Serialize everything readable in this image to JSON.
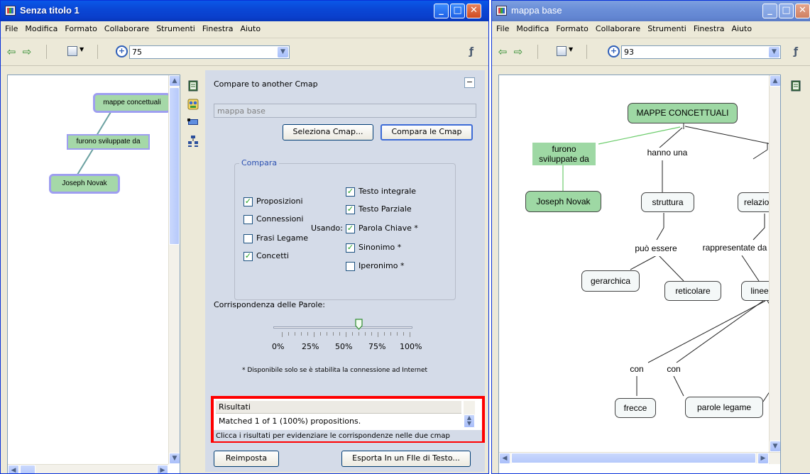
{
  "window1": {
    "title": "Senza titolo 1",
    "menu": [
      "File",
      "Modifica",
      "Formato",
      "Collaborare",
      "Strumenti",
      "Finestra",
      "Aiuto"
    ],
    "zoom": "75",
    "nodes": {
      "mappe": "mappe concettuali",
      "furono": "furono sviluppate da",
      "novak": "Joseph Novak"
    }
  },
  "panel": {
    "title": "Compare to another Cmap",
    "cmap_field": "mappa base",
    "select_button": "Seleziona Cmap...",
    "compare_button": "Compara le Cmap",
    "group_title": "Compara",
    "compare_items": [
      {
        "label": "Proposizioni",
        "checked": true
      },
      {
        "label": "Connessioni",
        "checked": false
      },
      {
        "label": "Frasi Legame",
        "checked": false
      },
      {
        "label": "Concetti",
        "checked": true
      }
    ],
    "using_label": "Usando:",
    "using_items": [
      {
        "label": "Testo integrale",
        "checked": true
      },
      {
        "label": "Testo Parziale",
        "checked": true
      },
      {
        "label": "Parola Chiave *",
        "checked": true
      },
      {
        "label": "Sinonimo *",
        "checked": true
      },
      {
        "label": "Iperonimo *",
        "checked": false
      }
    ],
    "slider_label": "Corrispondenza delle Parole:",
    "slider_value": 0.6,
    "slider_ticks": [
      "0%",
      "25%",
      "50%",
      "75%",
      "100%"
    ],
    "note": "* Disponibile solo se è stabilita la connessione ad Internet",
    "results_header": "Risultati",
    "results_row": "Matched 1 of 1 (100%) propositions.",
    "results_hint": "Clicca i risultati per evidenziare le corrispondenze nelle due cmap",
    "reset_button": "Reimposta",
    "export_button": "Esporta In un FIle di Testo..."
  },
  "window2": {
    "title": "mappa base",
    "menu": [
      "File",
      "Modifica",
      "Formato",
      "Collaborare",
      "Strumenti",
      "Finestra",
      "Aiuto"
    ],
    "zoom": "93",
    "nodes": {
      "mappe": "MAPPE CONCETTUALI",
      "furono": "furono sviluppate da",
      "hanno": "hanno una",
      "novak": "Joseph Novak",
      "struttura": "struttura",
      "relazioni": "relazio",
      "puo": "può essere",
      "rappresentate": "rappresentate da",
      "gerarchica": "gerarchica",
      "reticolare": "reticolare",
      "linee": "linee",
      "con1": "con",
      "con2": "con",
      "frecce": "frecce",
      "parole": "parole legame"
    }
  }
}
